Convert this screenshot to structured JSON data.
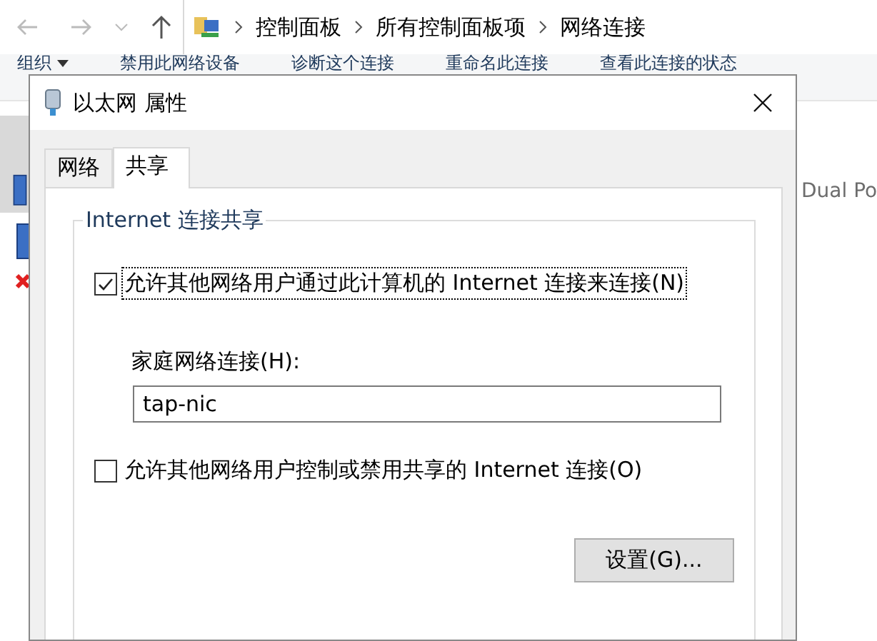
{
  "address_bar": {
    "path": [
      "控制面板",
      "所有控制面板项",
      "网络连接"
    ]
  },
  "toolbar": [
    {
      "label": "组织",
      "kind": "menu"
    },
    {
      "label": "禁用此网络设备",
      "kind": "action"
    },
    {
      "label": "诊断这个连接",
      "kind": "action"
    },
    {
      "label": "重命名此连接",
      "kind": "action"
    },
    {
      "label": "查看此连接的状态",
      "kind": "action"
    }
  ],
  "connections": [
    {
      "selected": true,
      "disabled": false,
      "detail": "Dual Po"
    },
    {
      "selected": false,
      "disabled": true
    }
  ],
  "dialog": {
    "title": "以太网 属性",
    "tabs": [
      {
        "label": "网络",
        "selected": false
      },
      {
        "label": "共享",
        "selected": true
      }
    ],
    "group_title": "Internet 连接共享",
    "sharing_option": {
      "label": "允许其他网络用户通过此计算机的 Internet 连接来连接(N)",
      "checked": true,
      "focused": true
    },
    "home_network": {
      "label": "家庭网络连接(H):",
      "value": "tap-nic"
    },
    "control_option": {
      "label": "允许其他网络用户控制或禁用共享的 Internet 连接(O)",
      "checked": false,
      "focused": false
    },
    "settings_button": "设置(G)..."
  }
}
